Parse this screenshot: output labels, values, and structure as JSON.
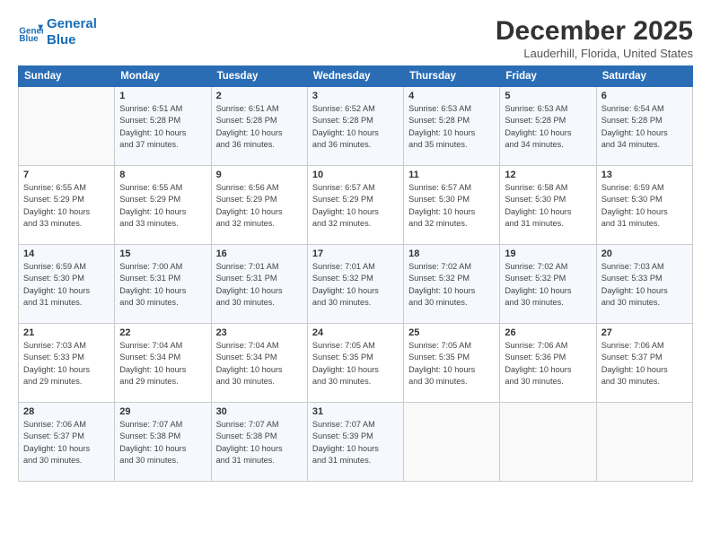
{
  "header": {
    "logo_line1": "General",
    "logo_line2": "Blue",
    "title": "December 2025",
    "location": "Lauderhill, Florida, United States"
  },
  "weekdays": [
    "Sunday",
    "Monday",
    "Tuesday",
    "Wednesday",
    "Thursday",
    "Friday",
    "Saturday"
  ],
  "weeks": [
    [
      {
        "day": "",
        "info": ""
      },
      {
        "day": "1",
        "info": "Sunrise: 6:51 AM\nSunset: 5:28 PM\nDaylight: 10 hours\nand 37 minutes."
      },
      {
        "day": "2",
        "info": "Sunrise: 6:51 AM\nSunset: 5:28 PM\nDaylight: 10 hours\nand 36 minutes."
      },
      {
        "day": "3",
        "info": "Sunrise: 6:52 AM\nSunset: 5:28 PM\nDaylight: 10 hours\nand 36 minutes."
      },
      {
        "day": "4",
        "info": "Sunrise: 6:53 AM\nSunset: 5:28 PM\nDaylight: 10 hours\nand 35 minutes."
      },
      {
        "day": "5",
        "info": "Sunrise: 6:53 AM\nSunset: 5:28 PM\nDaylight: 10 hours\nand 34 minutes."
      },
      {
        "day": "6",
        "info": "Sunrise: 6:54 AM\nSunset: 5:28 PM\nDaylight: 10 hours\nand 34 minutes."
      }
    ],
    [
      {
        "day": "7",
        "info": "Sunrise: 6:55 AM\nSunset: 5:29 PM\nDaylight: 10 hours\nand 33 minutes."
      },
      {
        "day": "8",
        "info": "Sunrise: 6:55 AM\nSunset: 5:29 PM\nDaylight: 10 hours\nand 33 minutes."
      },
      {
        "day": "9",
        "info": "Sunrise: 6:56 AM\nSunset: 5:29 PM\nDaylight: 10 hours\nand 32 minutes."
      },
      {
        "day": "10",
        "info": "Sunrise: 6:57 AM\nSunset: 5:29 PM\nDaylight: 10 hours\nand 32 minutes."
      },
      {
        "day": "11",
        "info": "Sunrise: 6:57 AM\nSunset: 5:30 PM\nDaylight: 10 hours\nand 32 minutes."
      },
      {
        "day": "12",
        "info": "Sunrise: 6:58 AM\nSunset: 5:30 PM\nDaylight: 10 hours\nand 31 minutes."
      },
      {
        "day": "13",
        "info": "Sunrise: 6:59 AM\nSunset: 5:30 PM\nDaylight: 10 hours\nand 31 minutes."
      }
    ],
    [
      {
        "day": "14",
        "info": "Sunrise: 6:59 AM\nSunset: 5:30 PM\nDaylight: 10 hours\nand 31 minutes."
      },
      {
        "day": "15",
        "info": "Sunrise: 7:00 AM\nSunset: 5:31 PM\nDaylight: 10 hours\nand 30 minutes."
      },
      {
        "day": "16",
        "info": "Sunrise: 7:01 AM\nSunset: 5:31 PM\nDaylight: 10 hours\nand 30 minutes."
      },
      {
        "day": "17",
        "info": "Sunrise: 7:01 AM\nSunset: 5:32 PM\nDaylight: 10 hours\nand 30 minutes."
      },
      {
        "day": "18",
        "info": "Sunrise: 7:02 AM\nSunset: 5:32 PM\nDaylight: 10 hours\nand 30 minutes."
      },
      {
        "day": "19",
        "info": "Sunrise: 7:02 AM\nSunset: 5:32 PM\nDaylight: 10 hours\nand 30 minutes."
      },
      {
        "day": "20",
        "info": "Sunrise: 7:03 AM\nSunset: 5:33 PM\nDaylight: 10 hours\nand 30 minutes."
      }
    ],
    [
      {
        "day": "21",
        "info": "Sunrise: 7:03 AM\nSunset: 5:33 PM\nDaylight: 10 hours\nand 29 minutes."
      },
      {
        "day": "22",
        "info": "Sunrise: 7:04 AM\nSunset: 5:34 PM\nDaylight: 10 hours\nand 29 minutes."
      },
      {
        "day": "23",
        "info": "Sunrise: 7:04 AM\nSunset: 5:34 PM\nDaylight: 10 hours\nand 30 minutes."
      },
      {
        "day": "24",
        "info": "Sunrise: 7:05 AM\nSunset: 5:35 PM\nDaylight: 10 hours\nand 30 minutes."
      },
      {
        "day": "25",
        "info": "Sunrise: 7:05 AM\nSunset: 5:35 PM\nDaylight: 10 hours\nand 30 minutes."
      },
      {
        "day": "26",
        "info": "Sunrise: 7:06 AM\nSunset: 5:36 PM\nDaylight: 10 hours\nand 30 minutes."
      },
      {
        "day": "27",
        "info": "Sunrise: 7:06 AM\nSunset: 5:37 PM\nDaylight: 10 hours\nand 30 minutes."
      }
    ],
    [
      {
        "day": "28",
        "info": "Sunrise: 7:06 AM\nSunset: 5:37 PM\nDaylight: 10 hours\nand 30 minutes."
      },
      {
        "day": "29",
        "info": "Sunrise: 7:07 AM\nSunset: 5:38 PM\nDaylight: 10 hours\nand 30 minutes."
      },
      {
        "day": "30",
        "info": "Sunrise: 7:07 AM\nSunset: 5:38 PM\nDaylight: 10 hours\nand 31 minutes."
      },
      {
        "day": "31",
        "info": "Sunrise: 7:07 AM\nSunset: 5:39 PM\nDaylight: 10 hours\nand 31 minutes."
      },
      {
        "day": "",
        "info": ""
      },
      {
        "day": "",
        "info": ""
      },
      {
        "day": "",
        "info": ""
      }
    ]
  ]
}
